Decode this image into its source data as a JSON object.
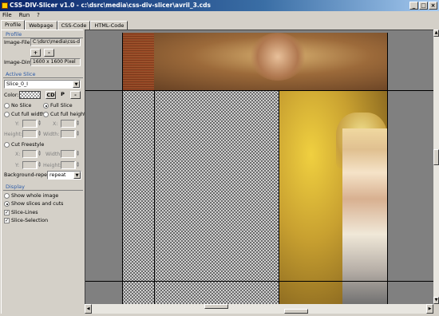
{
  "window": {
    "title": "CSS-DIV-Slicer v1.0  -  c:\\dsrc\\media\\css-div-slicer\\avril_3.cds",
    "minimize": "_",
    "maximize": "□",
    "close": "×"
  },
  "menu": [
    "File",
    "Run",
    "?"
  ],
  "tabs": [
    "Profile",
    "Webpage",
    "CSS-Code",
    "HTML-Code"
  ],
  "profile": {
    "heading": "Profile",
    "image_file_label": "Image-File:",
    "image_file_value": "C:\\dsrc\\media\\css-div-",
    "add_label": "+",
    "remove_label": "-",
    "image_dim_label": "Image-Dim:",
    "image_dim_value": "1600 x 1600 Pixel"
  },
  "active_slice": {
    "heading": "Active Slice",
    "selected": "Slice_0_I",
    "color_label": "Color:",
    "color_btn_cd": "CD",
    "color_btn_p": "P",
    "color_btn_minus": "-",
    "no_slice": "No Slice",
    "full_slice": "Full Slice",
    "cut_full_width": "Cut full width",
    "cut_full_height": "Cut full height",
    "y_label": "Y:",
    "x_label": "X:",
    "height_label": "Height:",
    "width_label": "Width:",
    "cut_freestyle": "Cut Freestyle",
    "x2_label": "X:",
    "width2_label": "Width:",
    "y2_label": "Y:",
    "height2_label": "Height:",
    "y_value": "",
    "x_value": "",
    "height_value": "",
    "width_value": "",
    "fx_value": "",
    "fwidth_value": "",
    "fy_value": "",
    "fheight_value": "",
    "bg_repeat_label": "Background-repeat:",
    "bg_repeat_value": "repeat"
  },
  "display": {
    "heading": "Display",
    "show_whole_image": "Show whole image",
    "show_slices": "Show slices and cuts",
    "slice_lines": "Slice-Lines",
    "slice_selection": "Slice-Selection"
  },
  "colors": {
    "title_start": "#0a246a",
    "title_end": "#a6caf0",
    "section_heading": "#2a5aa8",
    "window_bg": "#d4d0c8"
  }
}
